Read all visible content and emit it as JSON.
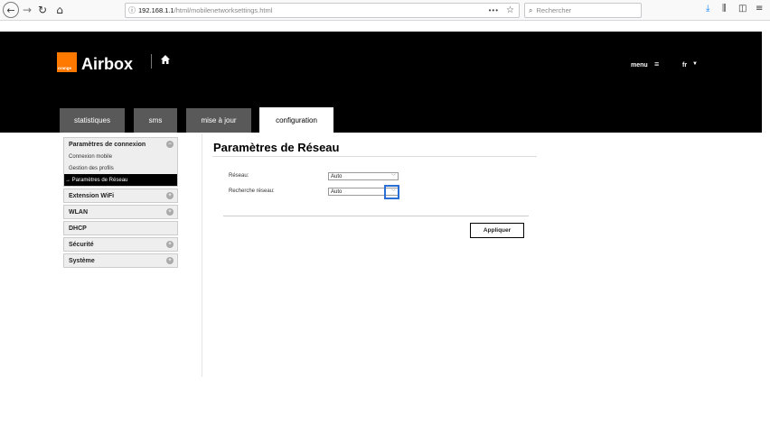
{
  "browser": {
    "url_host": "192.168.1.1",
    "url_path": "/html/mobilenetworksettings.html",
    "url_more": "•••",
    "search_placeholder": "Rechercher"
  },
  "header": {
    "logo_text": "orange",
    "brand": "Airbox",
    "menu_label": "menu",
    "lang": "fr",
    "brand_color": "#ff7900"
  },
  "tabs": [
    {
      "label": "statistiques",
      "active": false
    },
    {
      "label": "sms",
      "active": false
    },
    {
      "label": "mise à jour",
      "active": false
    },
    {
      "label": "configuration",
      "active": true
    }
  ],
  "sidebar": {
    "groups": [
      {
        "label": "Paramètres de connexion",
        "sub": [
          "Connexion mobile",
          "Gestion des profils",
          "→ Paramètres de Réseau"
        ]
      },
      {
        "label": "Extension WiFi"
      },
      {
        "label": "WLAN"
      },
      {
        "label": "DHCP"
      },
      {
        "label": "Sécurité"
      },
      {
        "label": "Système"
      }
    ]
  },
  "main": {
    "title": "Paramètres de Réseau",
    "fields": [
      {
        "label": "Réseau:",
        "value": "Auto"
      },
      {
        "label": "Recherche réseau:",
        "value": "Auto"
      }
    ],
    "apply_label": "Appliquer"
  }
}
